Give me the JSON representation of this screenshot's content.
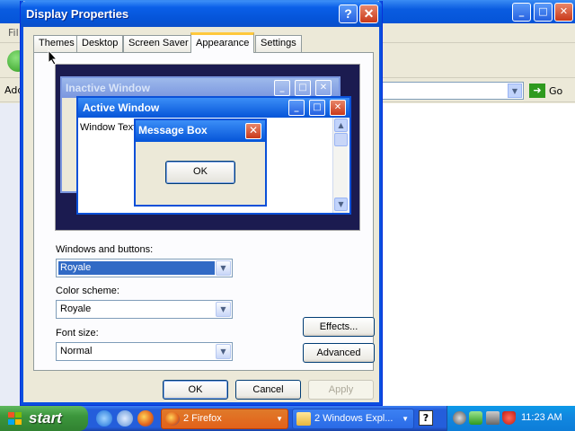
{
  "background_window": {
    "menu_first": "Fil",
    "address_label": "Add",
    "go_label": "Go"
  },
  "dialog": {
    "title": "Display Properties",
    "help_glyph": "?",
    "close_glyph": "✕",
    "tabs": [
      {
        "label": "Themes",
        "active": false
      },
      {
        "label": "Desktop",
        "active": false
      },
      {
        "label": "Screen Saver",
        "active": false
      },
      {
        "label": "Appearance",
        "active": true
      },
      {
        "label": "Settings",
        "active": false
      }
    ],
    "preview": {
      "inactive_title": "Inactive Window",
      "active_title": "Active Window",
      "window_text": "Window Text",
      "message_title": "Message Box",
      "message_ok": "OK"
    },
    "windows_buttons": {
      "label": "Windows and buttons:",
      "value": "Royale"
    },
    "color_scheme": {
      "label": "Color scheme:",
      "value": "Royale"
    },
    "font_size": {
      "label": "Font size:",
      "value": "Normal"
    },
    "effects_button": "Effects...",
    "advanced_button": "Advanced",
    "ok_button": "OK",
    "cancel_button": "Cancel",
    "apply_button": "Apply"
  },
  "taskbar": {
    "start_label": "start",
    "tasks": [
      {
        "label": "2 Firefox",
        "active": true
      },
      {
        "label": "2 Windows Expl...",
        "active": false
      }
    ],
    "help_icon": "?",
    "clock": "11:23 AM"
  },
  "colors": {
    "xp_blue": "#0554d8",
    "taskbar_blue": "#245edb",
    "start_green": "#3c963c",
    "firefox_orange": "#e2611a",
    "selection": "#316ac5"
  },
  "icons": [
    "help-icon",
    "close-icon",
    "minimize-icon",
    "maximize-icon",
    "chevron-down-icon",
    "go-arrow-icon",
    "windows-flag-icon",
    "ie-icon",
    "firefox-icon",
    "folder-icon",
    "shield-icon",
    "network-icon",
    "cursor-icon"
  ]
}
